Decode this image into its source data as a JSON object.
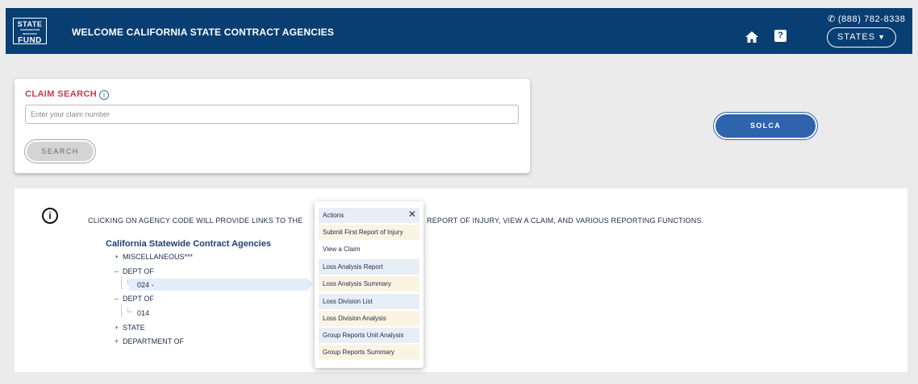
{
  "header": {
    "logo": {
      "line1": "STATE",
      "line2": "COMPENSATION INSURANCE",
      "line3": "FUND"
    },
    "welcome": "WELCOME CALIFORNIA STATE CONTRACT AGENCIES",
    "phone": "(888) 782-8338",
    "help_glyph": "?",
    "states_label": "STATES",
    "icons": {
      "home": "home-icon",
      "help": "help-icon",
      "phone": "phone-icon",
      "caret": "caret-down-icon"
    }
  },
  "claim_search": {
    "title": "CLAIM SEARCH",
    "info_glyph": "i",
    "placeholder": "Enter your claim number",
    "value": "",
    "search_label": "SEARCH"
  },
  "solca_label": "SOLCA",
  "notice": {
    "info_glyph": "i",
    "left": "CLICKING ON AGENCY CODE WILL PROVIDE LINKS TO THE",
    "right": "REPORT OF INJURY, VIEW A CLAIM, AND VARIOUS REPORTING FUNCTIONS."
  },
  "tree": {
    "title": "California Statewide Contract Agencies",
    "nodes": [
      {
        "symbol": "+",
        "label": "MISCELLANEOUS***"
      },
      {
        "symbol": "–",
        "label": "DEPT OF"
      },
      {
        "symbol": "",
        "label": "024 -",
        "selected": true
      },
      {
        "symbol": "–",
        "label": "DEPT OF"
      },
      {
        "symbol": "",
        "label": "014"
      },
      {
        "symbol": "+",
        "label": "STATE"
      },
      {
        "symbol": "+",
        "label": "DEPARTMENT OF"
      }
    ]
  },
  "actions_popup": {
    "title": "Actions",
    "close": "✕",
    "items": [
      "Submit First Report of Injury",
      "View a Claim",
      "Loss Analysis Report",
      "Loss Analysis Summary",
      "Loss Division List",
      "Loss Division Analysis",
      "Group Reports Unit Analysis",
      "Group Reports Summary"
    ]
  },
  "colors": {
    "header_bg": "#093e73",
    "accent_red": "#d0374f",
    "button_blue": "#2e63ad"
  }
}
